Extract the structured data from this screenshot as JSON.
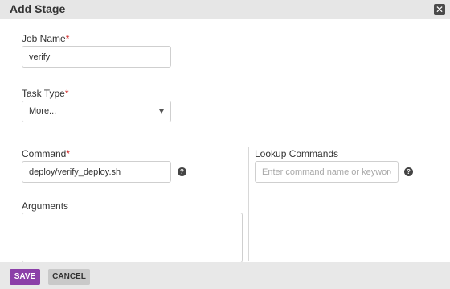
{
  "dialog": {
    "title": "Add Stage",
    "close_symbol": "✕"
  },
  "form": {
    "job_name": {
      "label": "Job Name",
      "required_mark": "*",
      "value": "verify"
    },
    "task_type": {
      "label": "Task Type",
      "required_mark": "*",
      "selected": "More..."
    },
    "command": {
      "label": "Command",
      "required_mark": "*",
      "value": "deploy/verify_deploy.sh",
      "help_symbol": "?"
    },
    "lookup": {
      "label": "Lookup Commands",
      "placeholder": "Enter command name or keyword",
      "help_symbol": "?"
    },
    "arguments": {
      "label": "Arguments",
      "value": ""
    }
  },
  "footer": {
    "save_label": "SAVE",
    "cancel_label": "CANCEL"
  },
  "colors": {
    "accent": "#8b3fa8",
    "required": "#d02020",
    "titlebar": "#e6e6e6",
    "footer": "#e8e8e8"
  }
}
